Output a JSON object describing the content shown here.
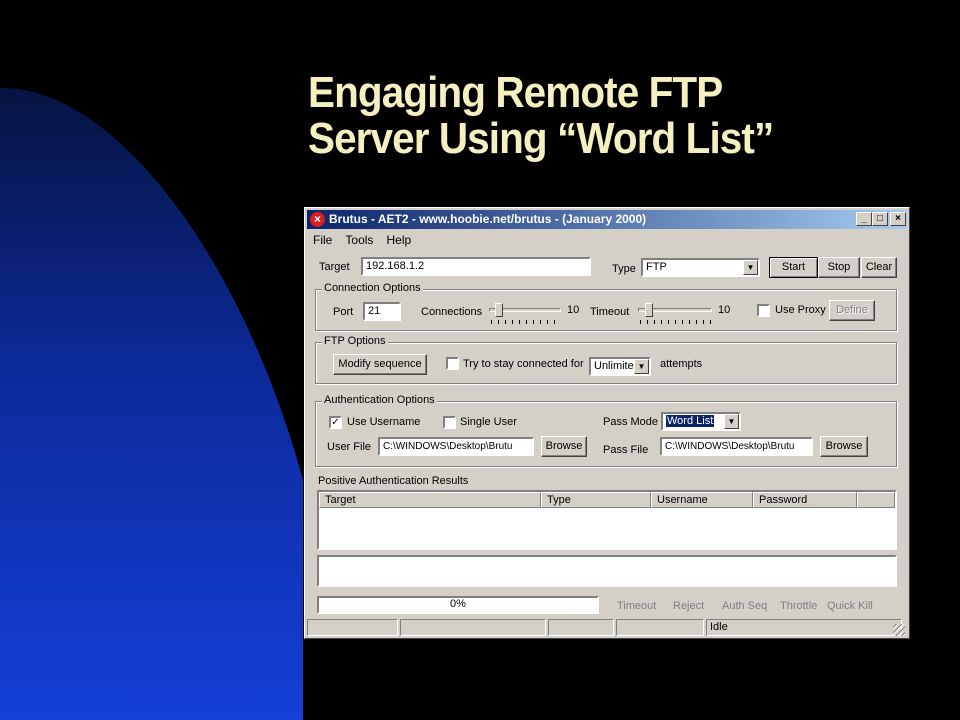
{
  "slide": {
    "title_line1": "Engaging Remote FTP",
    "title_line2": "Server Using “Word List”"
  },
  "window": {
    "title": "Brutus - AET2 - www.hoobie.net/brutus - (January 2000)",
    "app_icon": "x-icon",
    "controls": {
      "minimize": "_",
      "maximize": "□",
      "close": "×"
    },
    "menu": [
      "File",
      "Tools",
      "Help"
    ]
  },
  "target": {
    "label": "Target",
    "value": "192.168.1.2",
    "type_label": "Type",
    "type_value": "FTP",
    "start_label": "Start",
    "stop_label": "Stop",
    "clear_label": "Clear"
  },
  "connection_options": {
    "legend": "Connection Options",
    "port_label": "Port",
    "port_value": "21",
    "connections_label": "Connections",
    "connections_value": "10",
    "connections_level": 0.1,
    "timeout_label": "Timeout",
    "timeout_value": "10",
    "timeout_level": 0.1,
    "use_proxy_label": "Use Proxy",
    "use_proxy_checked": false,
    "define_label": "Define"
  },
  "ftp_options": {
    "legend": "FTP Options",
    "modify_sequence_label": "Modify sequence",
    "stay_connected_label": "Try to stay connected for",
    "stay_connected_checked": false,
    "attempts_value": "Unlimite",
    "attempts_label": "attempts"
  },
  "auth_options": {
    "legend": "Authentication Options",
    "use_username_label": "Use Username",
    "use_username_checked": true,
    "check_mark": "✓",
    "single_user_label": "Single User",
    "single_user_checked": false,
    "pass_mode_label": "Pass Mode",
    "pass_mode_value": "Word List",
    "user_file_label": "User File",
    "user_file_value": "C:\\WINDOWS\\Desktop\\Brutu",
    "user_browse_label": "Browse",
    "pass_file_label": "Pass File",
    "pass_file_value": "C:\\WINDOWS\\Desktop\\Brutu",
    "pass_browse_label": "Browse"
  },
  "results": {
    "heading": "Positive Authentication Results",
    "columns": [
      "Target",
      "Type",
      "Username",
      "Password"
    ]
  },
  "progress": {
    "value": 0,
    "text": "0%",
    "stats": [
      "Timeout",
      "Reject",
      "Auth Seq",
      "Throttle",
      "Quick Kill"
    ]
  },
  "statusbar": {
    "state": "Idle"
  },
  "colors": {
    "title_text": "#f4f0c0",
    "blue_shape": "#1440d8",
    "window_face": "#d4d0c8",
    "titlebar_start": "#0a246a",
    "titlebar_end": "#a6caf0",
    "selection": "#0a246a"
  }
}
